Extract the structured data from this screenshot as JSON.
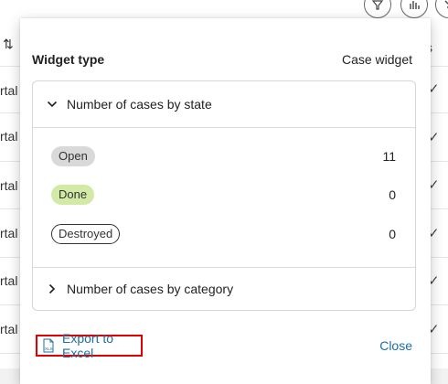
{
  "background": {
    "row_fragments": [
      "rtal",
      "rtal",
      "rtal",
      "rtal",
      "rtal",
      "rtal"
    ],
    "sort_icon": "sort-arrows-icon",
    "column_fragment": "s",
    "check_icon": "checkmark-icon",
    "toolbar_icons": [
      "filter-icon",
      "chart-icon",
      "collapse-icon"
    ]
  },
  "dialog": {
    "widget_type_label": "Widget type",
    "widget_type_value": "Case widget",
    "sections": [
      {
        "title": "Number of cases by state",
        "expanded": true,
        "icon": "chevron-down-icon",
        "rows": [
          {
            "state": "Open",
            "count": "11",
            "color": "#d9d9d9"
          },
          {
            "state": "Done",
            "count": "0",
            "color": "#d2eaa6"
          },
          {
            "state": "Destroyed",
            "count": "0",
            "color": "#ffffff"
          }
        ]
      },
      {
        "title": "Number of cases by category",
        "expanded": false,
        "icon": "chevron-right-icon"
      }
    ],
    "export_label": "Export to Excel",
    "export_icon": "excel-file-icon",
    "close_label": "Close",
    "accent_color": "#1c6fa8",
    "highlight_color": "#e00000"
  }
}
